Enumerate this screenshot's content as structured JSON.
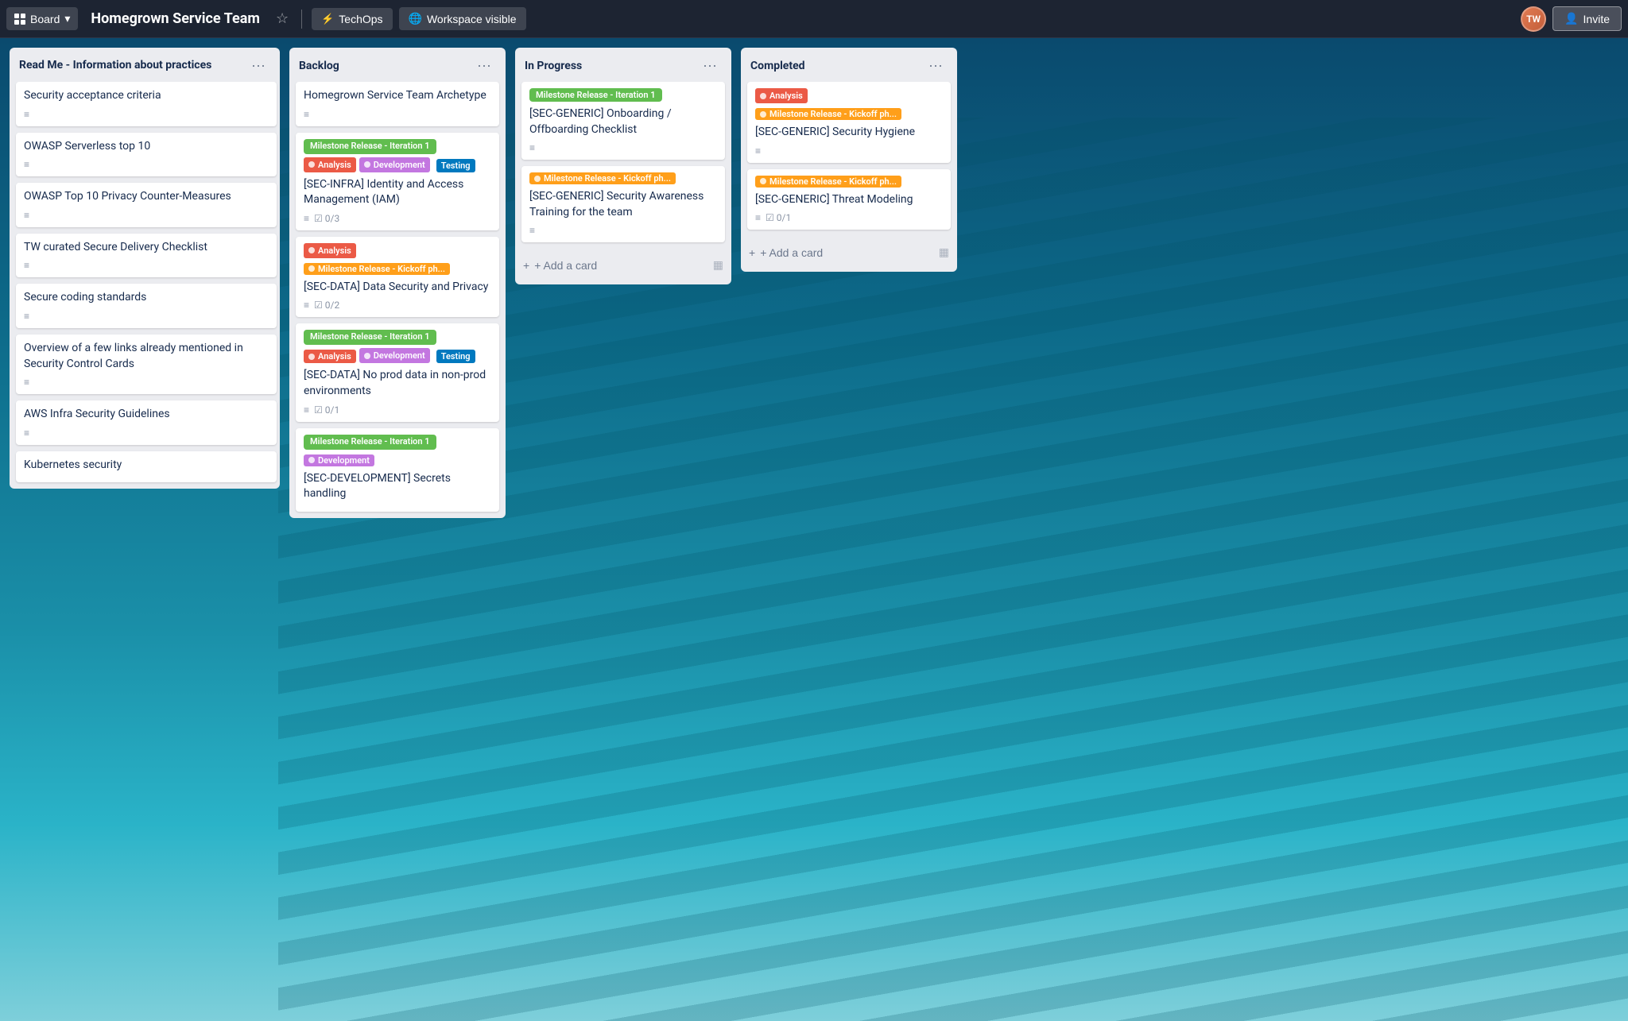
{
  "header": {
    "board_label": "Board",
    "title": "Homegrown Service Team",
    "star_icon": "☆",
    "techops_label": "TechOps",
    "workspace_label": "Workspace visible",
    "invite_label": "Invite"
  },
  "columns": [
    {
      "id": "readme",
      "title": "Read Me - Information about practices",
      "cards": [
        {
          "id": "rc1",
          "title": "Security acceptance criteria",
          "has_desc": true
        },
        {
          "id": "rc2",
          "title": "OWASP Serverless top 10",
          "has_desc": true
        },
        {
          "id": "rc3",
          "title": "OWASP Top 10 Privacy Counter-Measures",
          "has_desc": true
        },
        {
          "id": "rc4",
          "title": "TW curated Secure Delivery Checklist",
          "has_desc": true
        },
        {
          "id": "rc5",
          "title": "Secure coding standards",
          "has_desc": true
        },
        {
          "id": "rc6",
          "title": "Overview of a few links already mentioned in Security Control Cards",
          "has_desc": true
        },
        {
          "id": "rc7",
          "title": "AWS Infra Security Guidelines",
          "has_desc": true
        },
        {
          "id": "rc8",
          "title": "Kubernetes security",
          "has_desc": false
        }
      ]
    },
    {
      "id": "backlog",
      "title": "Backlog",
      "cards": [
        {
          "id": "bc1",
          "title": "Homegrown Service Team Archetype",
          "has_desc": true,
          "labels": []
        },
        {
          "id": "bc2",
          "title": "[SEC-INFRA] Identity and Access Management (IAM)",
          "has_desc": true,
          "labels": [
            {
              "text": "Milestone Release - Iteration 1",
              "color": "green"
            },
            {
              "text": "Analysis",
              "color": "red-dot"
            },
            {
              "text": "Development",
              "color": "purple-dot"
            },
            {
              "text": "Testing",
              "color": "blue"
            }
          ],
          "checklist": "0/3"
        },
        {
          "id": "bc3",
          "title": "[SEC-DATA] Data Security and Privacy",
          "has_desc": true,
          "labels": [
            {
              "text": "Analysis",
              "color": "red-dot"
            },
            {
              "text": "Milestone Release - Kickoff ph...",
              "color": "orange-dot"
            }
          ],
          "checklist": "0/2"
        },
        {
          "id": "bc4",
          "title": "[SEC-DATA] No prod data in non-prod environments",
          "has_desc": true,
          "labels": [
            {
              "text": "Milestone Release - Iteration 1",
              "color": "green"
            },
            {
              "text": "Analysis",
              "color": "red-dot"
            },
            {
              "text": "Development",
              "color": "purple-dot"
            },
            {
              "text": "Testing",
              "color": "blue"
            }
          ],
          "checklist": "0/1"
        },
        {
          "id": "bc5",
          "title": "[SEC-DEVELOPMENT] Secrets handling",
          "has_desc": false,
          "labels": [
            {
              "text": "Milestone Release - Iteration 1",
              "color": "green"
            },
            {
              "text": "Development",
              "color": "purple-dot"
            }
          ]
        }
      ]
    },
    {
      "id": "inprogress",
      "title": "In Progress",
      "cards": [
        {
          "id": "ip1",
          "title": "[SEC-GENERIC] Onboarding / Offboarding Checklist",
          "has_desc": true,
          "labels": [
            {
              "text": "Milestone Release - Iteration 1",
              "color": "green"
            }
          ]
        },
        {
          "id": "ip2",
          "title": "[SEC-GENERIC] Security Awareness Training for the team",
          "has_desc": true,
          "labels": [
            {
              "text": "Milestone Release - Kickoff ph...",
              "color": "orange-dot"
            }
          ]
        }
      ]
    },
    {
      "id": "completed",
      "title": "Completed",
      "cards": [
        {
          "id": "cp1",
          "title": "[SEC-GENERIC] Security Hygiene",
          "has_desc": true,
          "labels": [
            {
              "text": "Analysis",
              "color": "red-dot"
            },
            {
              "text": "Milestone Release - Kickoff ph...",
              "color": "orange-dot"
            }
          ]
        },
        {
          "id": "cp2",
          "title": "[SEC-GENERIC] Threat Modeling",
          "has_desc": true,
          "labels": [
            {
              "text": "Milestone Release - Kickoff ph...",
              "color": "orange-dot"
            }
          ],
          "checklist": "0/1"
        }
      ]
    }
  ],
  "add_card_label": "+ Add a card",
  "three_dots": "···"
}
